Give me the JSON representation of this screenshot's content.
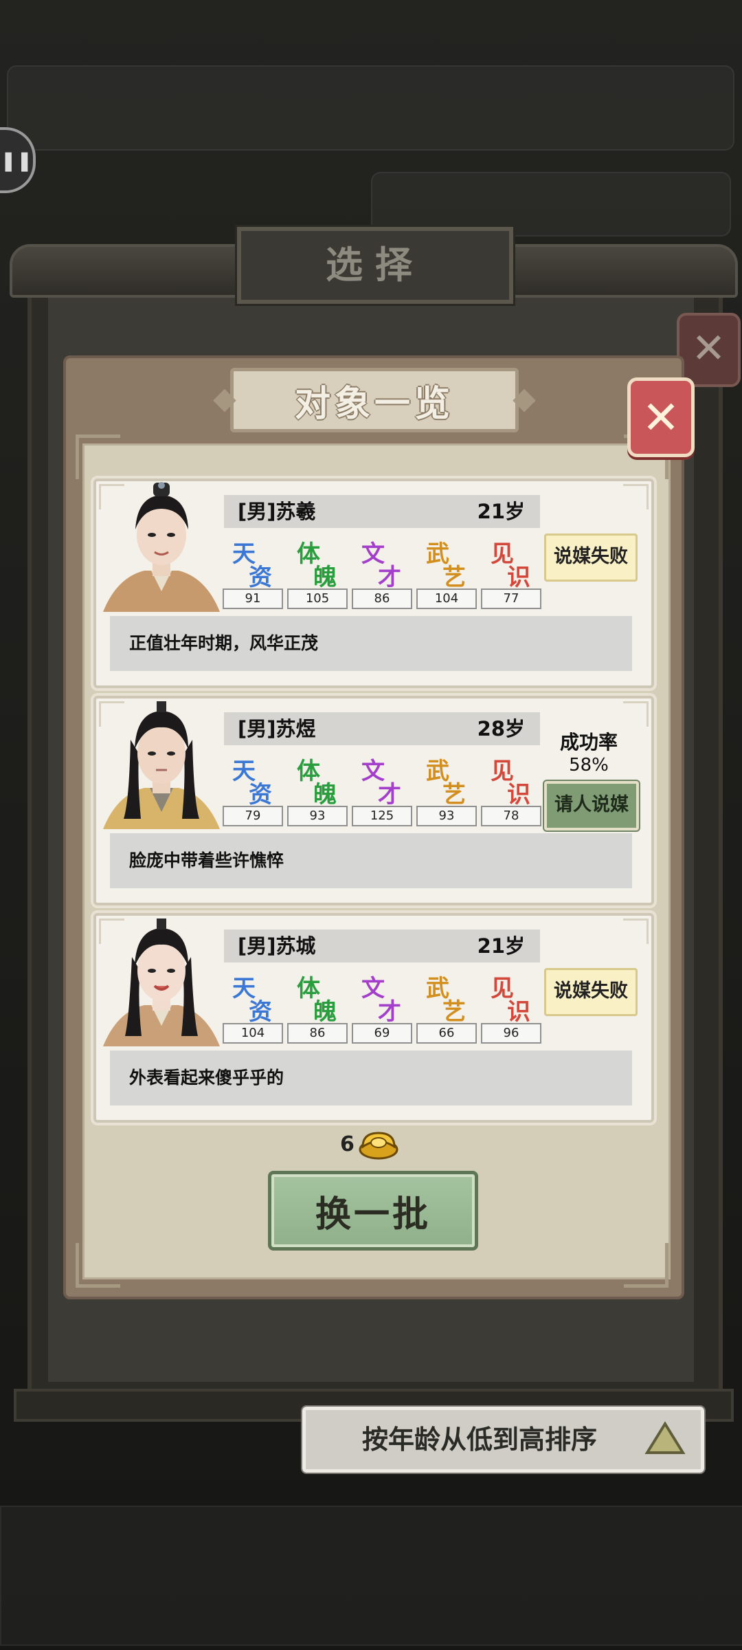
{
  "background": {
    "title": "选择"
  },
  "panel": {
    "title": "对象一览"
  },
  "candidates": [
    {
      "gender": "[男]",
      "name": "苏羲",
      "age": "21岁",
      "stats": [
        {
          "label": "天资",
          "value": "91",
          "color": "#3b78d6"
        },
        {
          "label": "体魄",
          "value": "105",
          "color": "#2a9e3f"
        },
        {
          "label": "文才",
          "value": "86",
          "color": "#a43fcb"
        },
        {
          "label": "武艺",
          "value": "104",
          "color": "#d28f1f"
        },
        {
          "label": "见识",
          "value": "77",
          "color": "#d4483c"
        }
      ],
      "description": "正值壮年时期，风华正茂",
      "action": "说媒失败"
    },
    {
      "gender": "[男]",
      "name": "苏煜",
      "age": "28岁",
      "stats": [
        {
          "label": "天资",
          "value": "79",
          "color": "#3b78d6"
        },
        {
          "label": "体魄",
          "value": "93",
          "color": "#2a9e3f"
        },
        {
          "label": "文才",
          "value": "125",
          "color": "#a43fcb"
        },
        {
          "label": "武艺",
          "value": "93",
          "color": "#d28f1f"
        },
        {
          "label": "见识",
          "value": "78",
          "color": "#d4483c"
        }
      ],
      "description": "脸庞中带着些许憔悴",
      "success_rate_label": "成功率",
      "success_rate": "58%",
      "action": "请人说媒"
    },
    {
      "gender": "[男]",
      "name": "苏城",
      "age": "21岁",
      "stats": [
        {
          "label": "天资",
          "value": "104",
          "color": "#3b78d6"
        },
        {
          "label": "体魄",
          "value": "86",
          "color": "#2a9e3f"
        },
        {
          "label": "文才",
          "value": "69",
          "color": "#a43fcb"
        },
        {
          "label": "武艺",
          "value": "66",
          "color": "#d28f1f"
        },
        {
          "label": "见识",
          "value": "96",
          "color": "#d4483c"
        }
      ],
      "description": "外表看起来傻乎乎的",
      "action": "说媒失败"
    }
  ],
  "cost": {
    "amount": "6",
    "icon": "gold-ingot-icon"
  },
  "refresh_label": "换一批",
  "sort_label": "按年龄从低到高排序",
  "icons": {
    "close": "close-icon",
    "sort": "sort-ascending-triangle-icon",
    "chat": "chat-bubble-icon"
  }
}
